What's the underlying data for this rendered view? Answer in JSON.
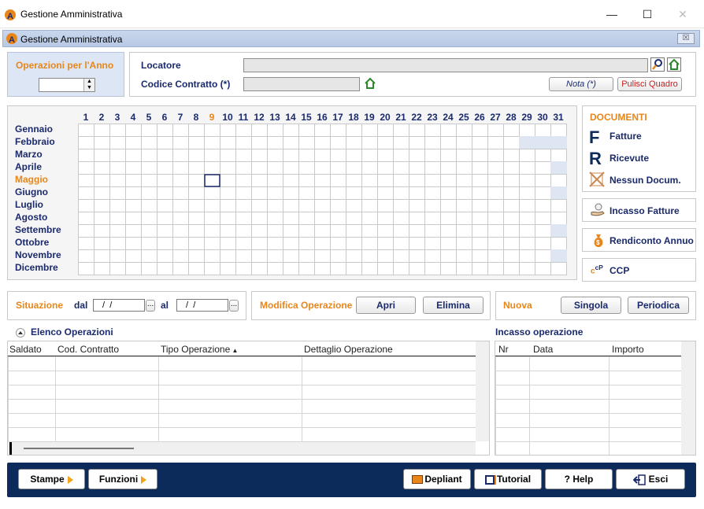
{
  "window": {
    "title": "Gestione Amministrativa",
    "minimize": "—",
    "maximize": "☐",
    "close": "✕"
  },
  "inner": {
    "title": "Gestione Amministrativa",
    "close": "☒"
  },
  "ops_year": {
    "label": "Operazioni per l'Anno",
    "value": ""
  },
  "locatore": {
    "label": "Locatore",
    "value": ""
  },
  "contratto": {
    "label": "Codice Contratto (*)",
    "value": ""
  },
  "nota_label": "Nota (*)",
  "pulisci_label": "Pulisci Quadro",
  "calendar": {
    "days": [
      "1",
      "2",
      "3",
      "4",
      "5",
      "6",
      "7",
      "8",
      "9",
      "10",
      "11",
      "12",
      "13",
      "14",
      "15",
      "16",
      "17",
      "18",
      "19",
      "20",
      "21",
      "22",
      "23",
      "24",
      "25",
      "26",
      "27",
      "28",
      "29",
      "30",
      "31"
    ],
    "highlight_day": "9",
    "months": [
      "Gennaio",
      "Febbraio",
      "Marzo",
      "Aprile",
      "Maggio",
      "Giugno",
      "Luglio",
      "Agosto",
      "Settembre",
      "Ottobre",
      "Novembre",
      "Dicembre"
    ],
    "highlight_month": "Maggio",
    "days_in_month": [
      31,
      28,
      31,
      30,
      31,
      30,
      31,
      31,
      30,
      31,
      30,
      31
    ],
    "colors": {
      "grid": "#c9c9c9",
      "disabled": "#dfe6f3",
      "highlight": "#e8861a",
      "selected": "#1a2a6c"
    }
  },
  "documenti": {
    "title": "DOCUMENTI",
    "fatture": "Fatture",
    "ricevute": "Ricevute",
    "nessun": "Nessun Docum."
  },
  "incasso_fatture": "Incasso Fatture",
  "rendiconto": "Rendiconto Annuo",
  "ccp": "CCP",
  "situazione": {
    "label": "Situazione",
    "dal": "dal",
    "al": "al",
    "from": " /  / ",
    "to": " /  / ",
    "ellipsis": "..."
  },
  "modifica": {
    "label": "Modifica Operazione",
    "apri": "Apri",
    "elimina": "Elimina"
  },
  "nuova": {
    "label": "Nuova",
    "singola": "Singola",
    "periodica": "Periodica"
  },
  "elenco": {
    "title": "Elenco Operazioni",
    "columns": [
      "Saldato",
      "Cod. Contratto",
      "Tipo Operazione",
      "Dettaglio Operazione"
    ],
    "rows": 6
  },
  "incasso": {
    "title": "Incasso operazione",
    "columns": [
      "Nr",
      "Data",
      "Importo"
    ],
    "rows": 7
  },
  "bottom": {
    "stampe": "Stampe",
    "funzioni": "Funzioni",
    "depliant": "Depliant",
    "tutorial": "Tutorial",
    "help": "? Help",
    "esci": "Esci"
  }
}
